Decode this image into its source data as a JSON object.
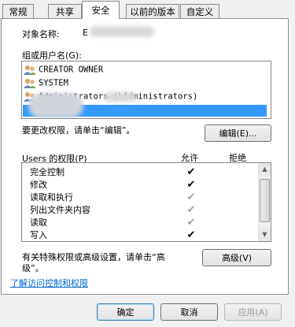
{
  "tabs": [
    {
      "label": "常规"
    },
    {
      "label": "共享"
    },
    {
      "label": "安全"
    },
    {
      "label": "以前的版本"
    },
    {
      "label": "自定义"
    }
  ],
  "object_name_label": "对象名称:",
  "object_name_value": "E",
  "group_label": "组或用户名(G):",
  "users": [
    {
      "name": "CREATOR OWNER"
    },
    {
      "name": "SYSTEM"
    },
    {
      "name": "Administrators (\\Administrators)"
    }
  ],
  "change_perm_text": "要更改权限，请单击“编辑”。",
  "edit_button": "编辑(E)...",
  "perm_label": "Users 的权限(P)",
  "allow_header": "允许",
  "deny_header": "拒绝",
  "permissions": [
    {
      "name": "完全控制",
      "allow": "✔",
      "state": "checked"
    },
    {
      "name": "修改",
      "allow": "✔",
      "state": "checked"
    },
    {
      "name": "读取和执行",
      "allow": "✔",
      "state": "inherited"
    },
    {
      "name": "列出文件夹内容",
      "allow": "✔",
      "state": "inherited"
    },
    {
      "name": "读取",
      "allow": "✔",
      "state": "inherited"
    },
    {
      "name": "写入",
      "allow": "✔",
      "state": "checked"
    }
  ],
  "special_text_line1": "有关特殊权限或高级设置，请单击“高",
  "special_text_line2": "级”。",
  "advanced_button": "高级(V)",
  "learn_link": "了解访问控制和权限",
  "footer": {
    "ok": "确定",
    "cancel": "取消",
    "apply": "应用(A)"
  },
  "colors": {
    "selection": "#3399ff",
    "link": "#0066cc",
    "panel_border": "#898c95"
  }
}
